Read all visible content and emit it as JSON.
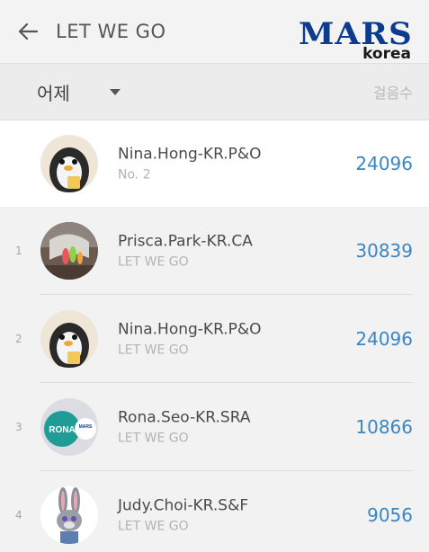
{
  "header": {
    "title": "LET WE GO",
    "logo_brand": "MARS",
    "logo_region": "korea"
  },
  "filter": {
    "period_label": "어제",
    "steps_column_label": "걸음수"
  },
  "my_entry": {
    "name": "Nina.Hong-KR.P&O",
    "rank_text": "No. 2",
    "steps": "24096",
    "avatar": "penguin-avatar"
  },
  "leaderboard": [
    {
      "rank": "1",
      "name": "Prisca.Park-KR.CA",
      "team": "LET WE GO",
      "steps": "30839",
      "avatar": "flower-photo-avatar"
    },
    {
      "rank": "2",
      "name": "Nina.Hong-KR.P&O",
      "team": "LET WE GO",
      "steps": "24096",
      "avatar": "penguin-avatar"
    },
    {
      "rank": "3",
      "name": "Rona.Seo-KR.SRA",
      "team": "LET WE GO",
      "steps": "10866",
      "avatar": "rona-badge-avatar"
    },
    {
      "rank": "4",
      "name": "Judy.Choi-KR.S&F",
      "team": "LET WE GO",
      "steps": "9056",
      "avatar": "bunny-avatar"
    }
  ],
  "avatar_texts": {
    "rona_badge_text": "RONA",
    "mars_pin_text": "MARS"
  },
  "colors": {
    "accent_blue": "#3a86c2",
    "logo_blue": "#0d3c8c",
    "rona_teal": "#1f9c96"
  }
}
